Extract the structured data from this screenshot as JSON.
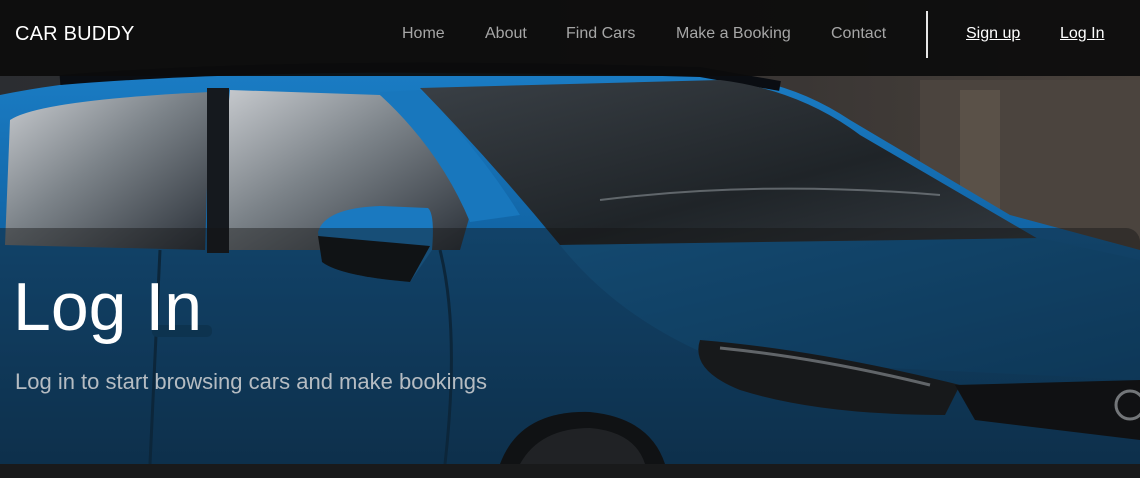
{
  "brand": "CAR BUDDY",
  "nav": {
    "links": [
      "Home",
      "About",
      "Find Cars",
      "Make a Booking",
      "Contact"
    ],
    "signup_label": "Sign up",
    "login_label": "Log In"
  },
  "hero": {
    "title": "Log In",
    "subtitle": "Log in to start browsing cars and make bookings"
  },
  "colors": {
    "car_blue": "#1366a8",
    "navbar_bg": "#0c0c0c",
    "link_muted": "#a6a6a6",
    "link_active": "#ffffff"
  }
}
